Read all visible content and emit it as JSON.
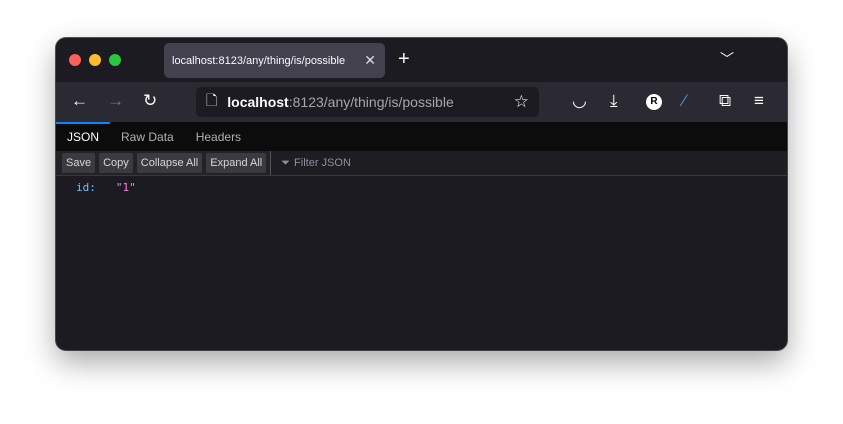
{
  "tab": {
    "title": "localhost:8123/any/thing/is/possible"
  },
  "url": {
    "host": "localhost",
    "path": ":8123/any/thing/is/possible"
  },
  "viewer_tabs": [
    "JSON",
    "Raw Data",
    "Headers"
  ],
  "buttons": {
    "save": "Save",
    "copy": "Copy",
    "collapse": "Collapse All",
    "expand": "Expand All"
  },
  "filter": {
    "placeholder": "Filter JSON"
  },
  "json": {
    "key": "id:",
    "value": "\"1\""
  },
  "account_initial": "R"
}
